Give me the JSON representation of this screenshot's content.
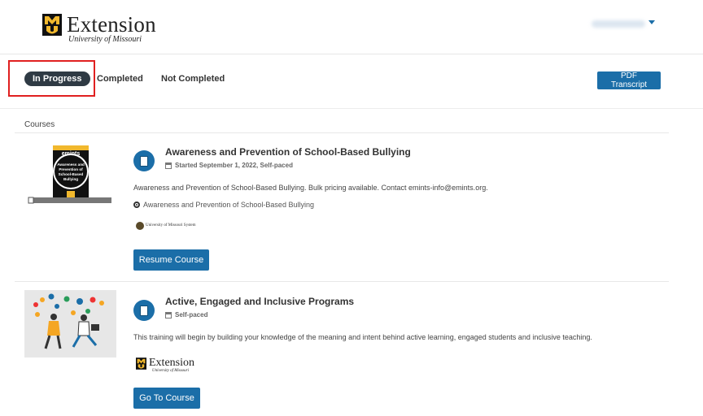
{
  "header": {
    "logo_title": "Extension",
    "logo_subtitle": "University of Missouri"
  },
  "tabs": {
    "in_progress": "In Progress",
    "completed": "Completed",
    "not_completed": "Not Completed",
    "active": "In Progress"
  },
  "actions": {
    "pdf_transcript": "PDF Transcript"
  },
  "section": {
    "label": "Courses"
  },
  "courses": [
    {
      "title": "Awareness and Prevention of School-Based Bullying",
      "meta": "Started September 1, 2022, Self-paced",
      "description": "Awareness and Prevention of School-Based Bullying. Bulk pricing available. Contact emints-info@emints.org.",
      "module": "Awareness and Prevention of School-Based Bullying",
      "provider": "University of Missouri System",
      "thumb_brand": "emints",
      "thumb_text": "Awareness and Prevention of School-Based Bullying",
      "button": "Resume Course"
    },
    {
      "title": "Active, Engaged and Inclusive Programs",
      "meta": "Self-paced",
      "description": "This training will begin by building your knowledge of the meaning and intent behind active learning, engaged students and inclusive teaching.",
      "provider_title": "Extension",
      "provider_subtitle": "University of Missouri",
      "button": "Go To Course"
    }
  ],
  "colors": {
    "accent": "#1b6ea8",
    "tab_active_bg": "#2f3a44",
    "highlight": "#e02020",
    "mizzou_gold": "#f1b82d"
  }
}
